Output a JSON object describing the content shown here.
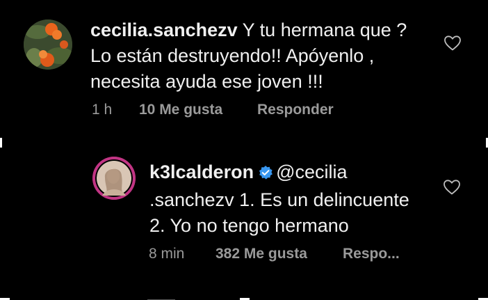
{
  "comment1": {
    "username": "cecilia.sanchezv",
    "text_line1": "Y tu hermana que ?",
    "text_line2": "Lo están destruyendo!! Apóyenlo ,",
    "text_line3": "necesita ayuda ese joven !!!",
    "time": "1 h",
    "likes": "10 Me gusta",
    "reply": "Responder",
    "avatar_icon": "flower-avatar-icon",
    "like_icon": "heart-outline-icon"
  },
  "reply1": {
    "username": "k3lcalderon",
    "verified_icon": "verified-badge-icon",
    "mention": "@cecilia",
    "text_line2": ".sanchezv 1. Es un delincuente",
    "text_line3": "2. Yo no tengo hermano",
    "time": "8 min",
    "likes": "382 Me gusta",
    "reply": "Respo...",
    "avatar_icon": "profile-photo-avatar-icon",
    "like_icon": "heart-outline-icon",
    "ring_color": "#c13584"
  },
  "colors": {
    "background": "#000000",
    "text": "#f0f0f0",
    "meta": "#9a9a9a",
    "verified": "#3897f0"
  }
}
